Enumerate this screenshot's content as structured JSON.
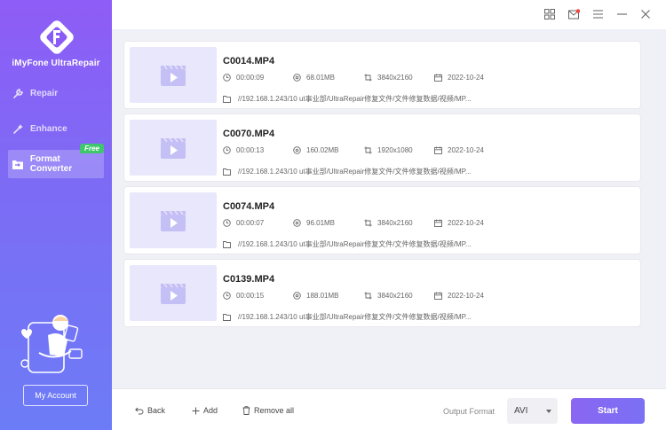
{
  "app": {
    "name": "iMyFone UltraRepair"
  },
  "sidebar": {
    "items": [
      {
        "label": "Repair",
        "icon": "repair-icon"
      },
      {
        "label": "Enhance",
        "icon": "enhance-icon"
      },
      {
        "label": "Format Converter",
        "icon": "format-converter-icon",
        "active": true,
        "badge": "Free"
      }
    ],
    "account_label": "My Account"
  },
  "files": [
    {
      "name": "C0014.MP4",
      "duration": "00:00:09",
      "size": "68.01MB",
      "resolution": "3840x2160",
      "date": "2022-10-24",
      "path": "//192.168.1.243/10 ut事业部/UltraRepair修复文件/文件修复数据/视频/MP..."
    },
    {
      "name": "C0070.MP4",
      "duration": "00:00:13",
      "size": "160.02MB",
      "resolution": "1920x1080",
      "date": "2022-10-24",
      "path": "//192.168.1.243/10 ut事业部/UltraRepair修复文件/文件修复数据/视频/MP..."
    },
    {
      "name": "C0074.MP4",
      "duration": "00:00:07",
      "size": "96.01MB",
      "resolution": "3840x2160",
      "date": "2022-10-24",
      "path": "//192.168.1.243/10 ut事业部/UltraRepair修复文件/文件修复数据/视频/MP..."
    },
    {
      "name": "C0139.MP4",
      "duration": "00:00:15",
      "size": "188.01MB",
      "resolution": "3840x2160",
      "date": "2022-10-24",
      "path": "//192.168.1.243/10 ut事业部/UltraRepair修复文件/文件修复数据/视频/MP..."
    }
  ],
  "footer": {
    "back_label": "Back",
    "add_label": "Add",
    "remove_label": "Remove all",
    "output_label": "Output Format",
    "output_value": "AVI",
    "start_label": "Start"
  },
  "colors": {
    "accent": "#8a66f2",
    "free_badge": "#3ec76b",
    "notify_dot": "#f04848"
  }
}
